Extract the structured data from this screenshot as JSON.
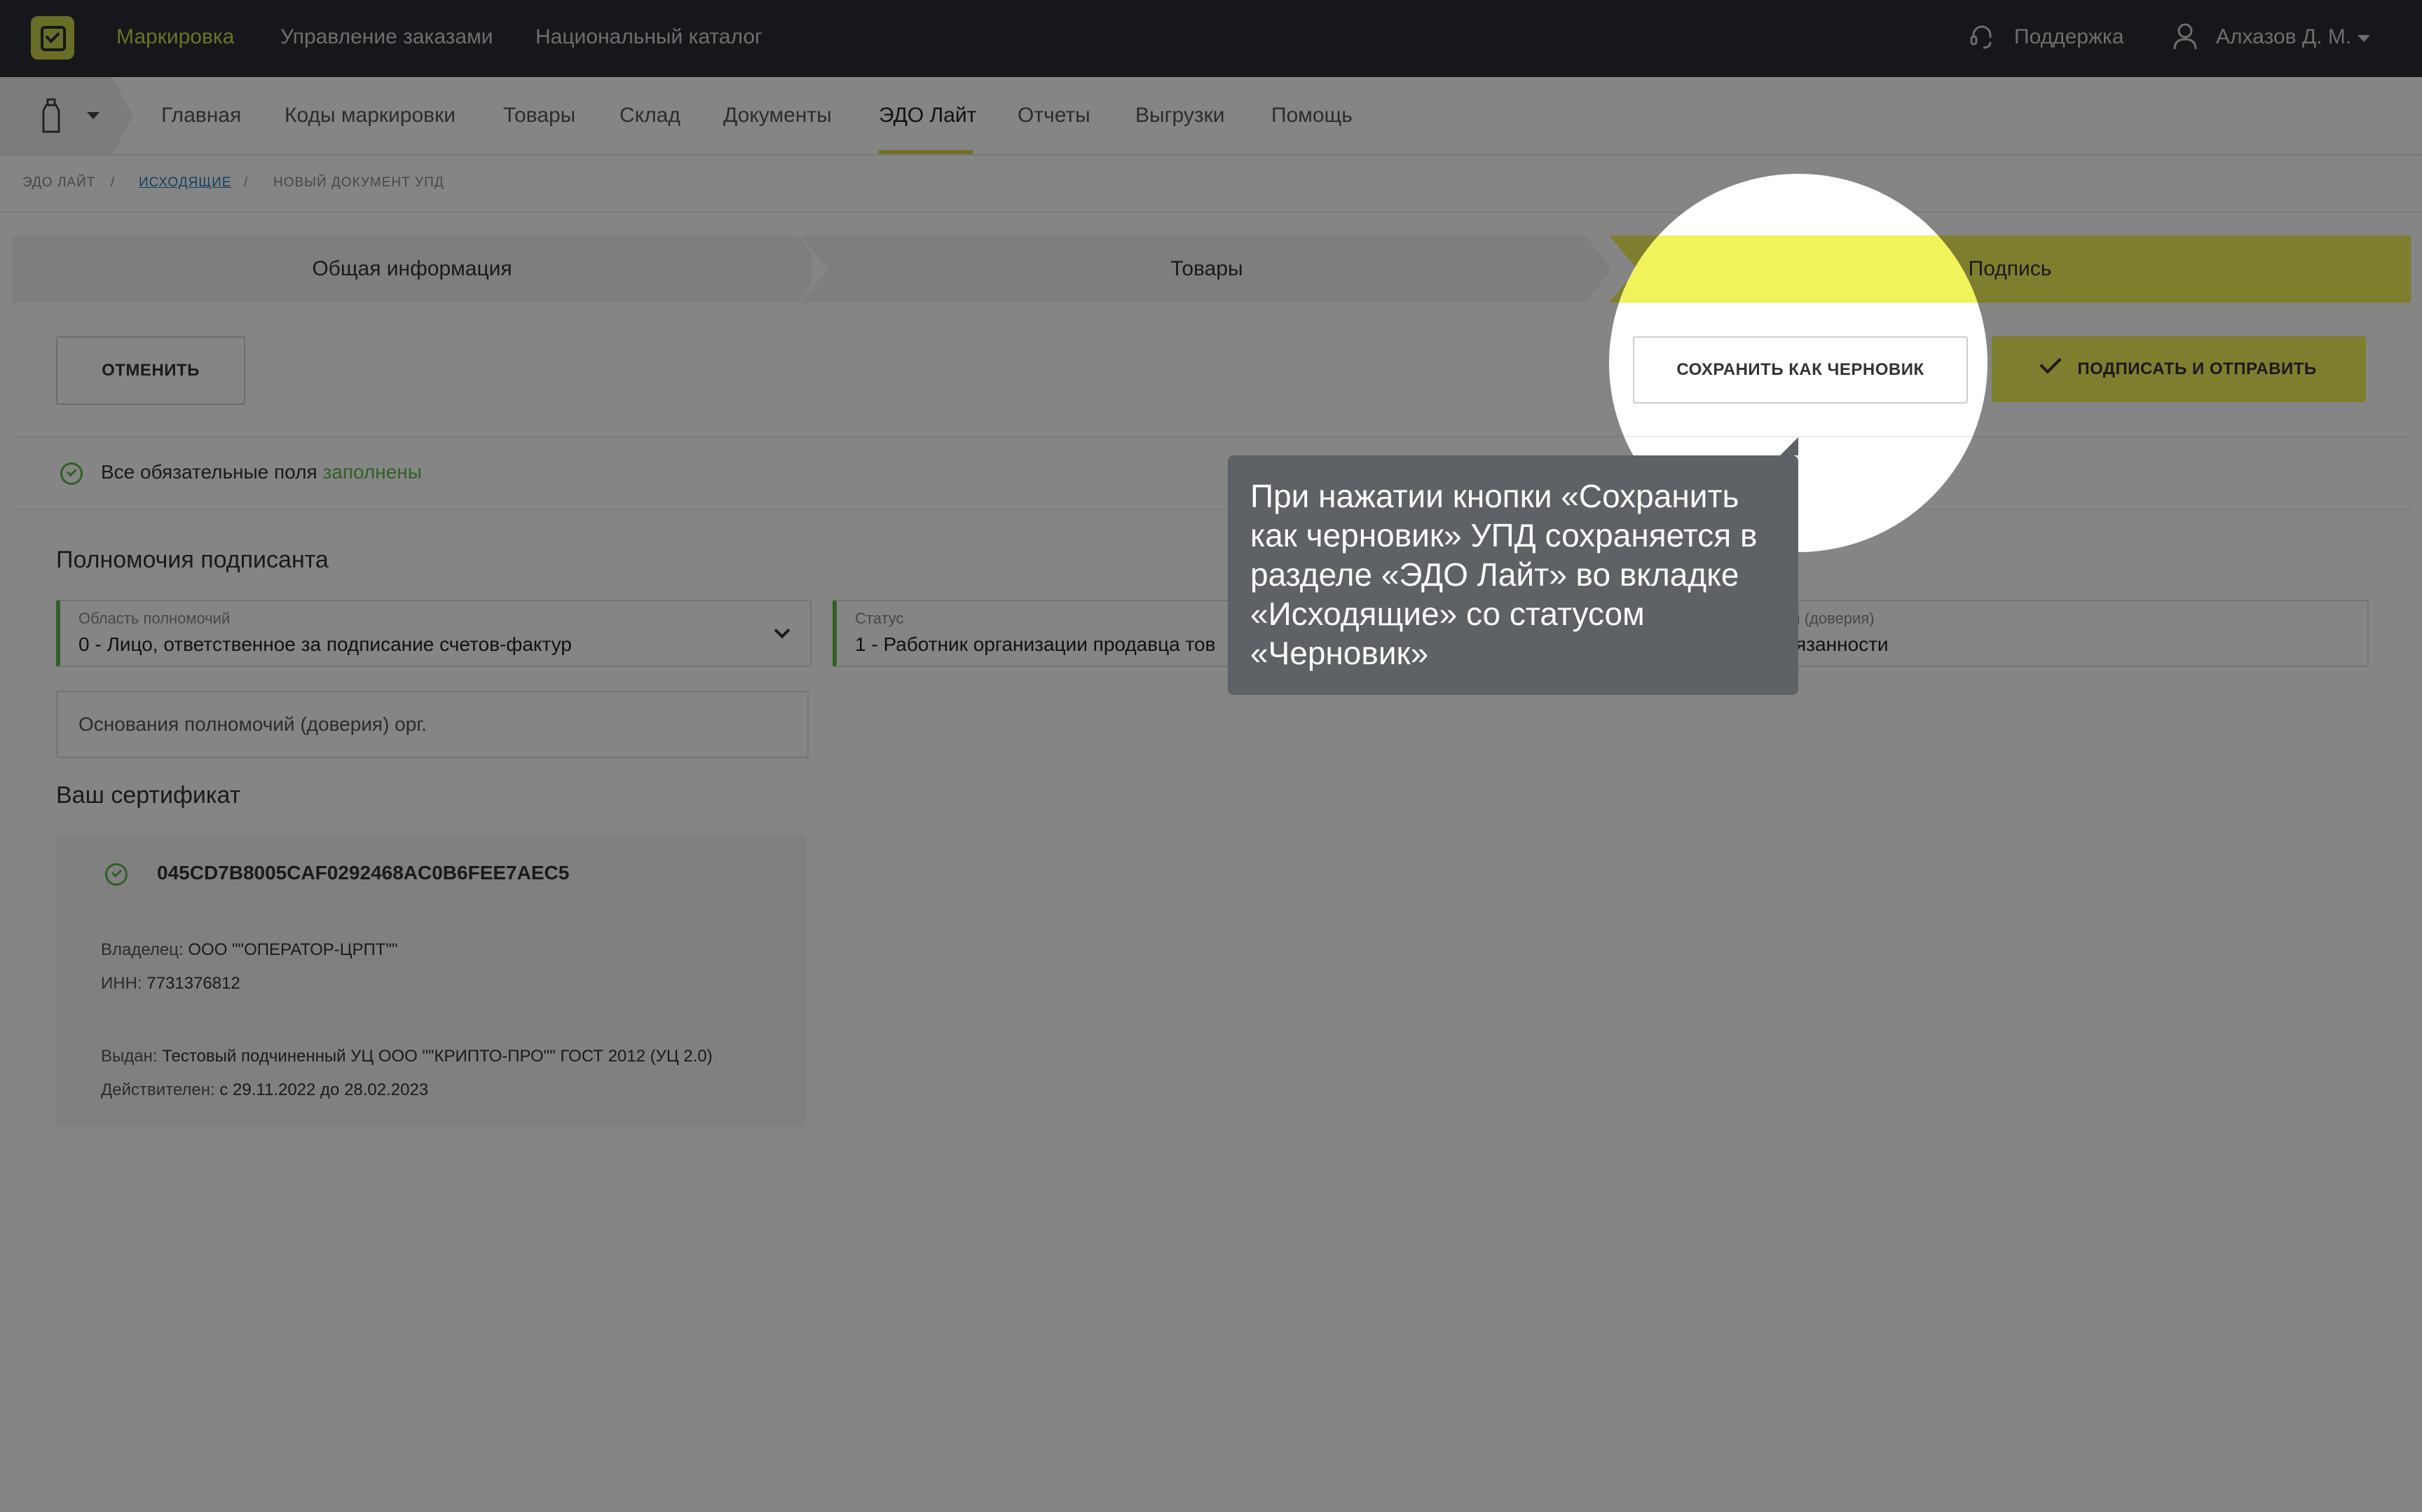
{
  "topbar": {
    "brand_nav": "Маркировка",
    "nav": [
      "Управление заказами",
      "Национальный каталог"
    ],
    "support_label": "Поддержка",
    "user_name": "Алхазов Д. М."
  },
  "subnav": {
    "items": [
      "Главная",
      "Коды маркировки",
      "Товары",
      "Склад",
      "Документы",
      "ЭДО Лайт",
      "Отчеты",
      "Выгрузки",
      "Помощь"
    ],
    "active": "ЭДО Лайт"
  },
  "breadcrumb": [
    "ЭДО ЛАЙТ",
    "ИСХОДЯЩИЕ",
    "НОВЫЙ ДОКУМЕНТ УПД"
  ],
  "breadcrumb_sep": "/",
  "steps": [
    "Общая информация",
    "Товары",
    "Подпись"
  ],
  "actions": {
    "cancel": "ОТМЕНИТЬ",
    "save_draft": "СОХРАНИТЬ КАК ЧЕРНОВИК",
    "sign_send": "ПОДПИСАТЬ И ОТПРАВИТЬ"
  },
  "validation": {
    "text": "Все обязательные поля",
    "status": "заполнены"
  },
  "signer": {
    "title": "Полномочия подписанта",
    "scope_label": "Область полномочий",
    "scope_value": "0 - Лицо, ответственное за подписание счетов-фактур",
    "status_label": "Статус",
    "status_value": "1 - Работник организации продавца тов",
    "basis_label_partial": "ий (доверия)",
    "basis_value_partial": "язанности",
    "org_basis_placeholder": "Основания полномочий (доверия) орг."
  },
  "certificate": {
    "title": "Ваш сертификат",
    "id": "045CD7B8005CAF0292468AC0B6FEE7AEC5",
    "owner_label": "Владелец:",
    "owner": "ООО \"\"ОПЕРАТОР-ЦРПТ\"\"",
    "inn_label": "ИНН:",
    "inn": "7731376812",
    "issuer_label": "Выдан:",
    "issuer": "Тестовый подчиненный УЦ ООО \"\"КРИПТО-ПРО\"\" ГОСТ 2012 (УЦ 2.0)",
    "valid_label": "Действителен:",
    "valid": "с 29.11.2022 до 28.02.2023"
  },
  "tooltip": {
    "text": "При нажатии кнопки «Сохранить как черновик» УПД сохраняется в разделе «ЭДО Лайт» во вкладке «Исходящие» со статусом «Черновик»"
  },
  "colors": {
    "accent_yellow": "#f2f25a",
    "nav_active": "#d2dc4a",
    "success_green": "#5ab84a",
    "topbar_bg": "#2a2d33",
    "link_blue": "#2a7ab8"
  },
  "icons": [
    "logo-icon",
    "headset-icon",
    "user-icon",
    "bottle-icon",
    "check-circle-icon",
    "check-icon",
    "chevron-down-icon"
  ]
}
